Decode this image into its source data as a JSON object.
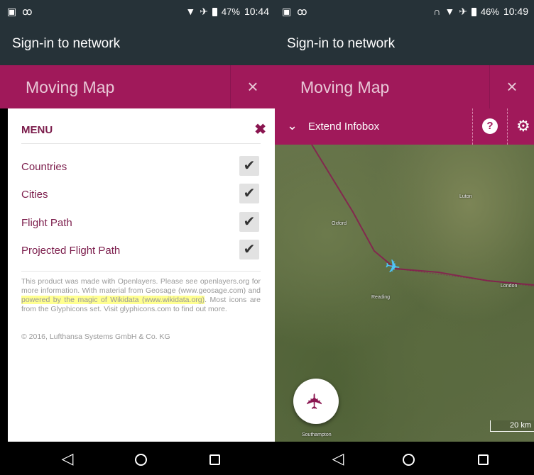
{
  "left": {
    "status": {
      "battery": "47%",
      "time": "10:44"
    },
    "appbar_title": "Sign-in to network",
    "map_header": {
      "title": "Moving Map",
      "close_glyph": "×"
    },
    "menu": {
      "title": "MENU",
      "close_glyph": "✖",
      "items": [
        {
          "label": "Countries",
          "checked": true
        },
        {
          "label": "Cities",
          "checked": true
        },
        {
          "label": "Flight Path",
          "checked": true
        },
        {
          "label": "Projected Flight Path",
          "checked": true
        }
      ],
      "credits": {
        "part1": "This product was made with Openlayers. Please see openlayers.org for more information. With material from Geosage (www.geosage.com) and ",
        "highlight": "powered by the magic of Wikidata (www.wikidata.org)",
        "part2": ". Most icons are from the Glyphicons set. Visit glyphicons.com to find out more."
      },
      "copyright": "© 2016, Lufthansa Systems GmbH & Co. KG"
    }
  },
  "right": {
    "status": {
      "battery": "46%",
      "time": "10:49"
    },
    "appbar_title": "Sign-in to network",
    "map_header": {
      "title": "Moving Map",
      "close_glyph": "×"
    },
    "infobox": {
      "label": "Extend Infobox",
      "help_glyph": "?",
      "settings_glyph": "⚙"
    },
    "map": {
      "places": [
        "Luton",
        "Oxford",
        "Reading",
        "London",
        "Southampton"
      ],
      "scale_label": "20 km"
    }
  },
  "icons": {
    "status_left": [
      "image-icon",
      "voicemail-icon"
    ],
    "status_right": [
      "headset-icon",
      "wifi-icon",
      "airplane-mode-icon",
      "battery-icon"
    ],
    "nav": [
      "back-icon",
      "home-icon",
      "recents-icon"
    ]
  },
  "colors": {
    "brand": "#a0195a",
    "appbar": "#263238",
    "plane": "#4fc3f7",
    "flight_path": "#8a1550"
  }
}
